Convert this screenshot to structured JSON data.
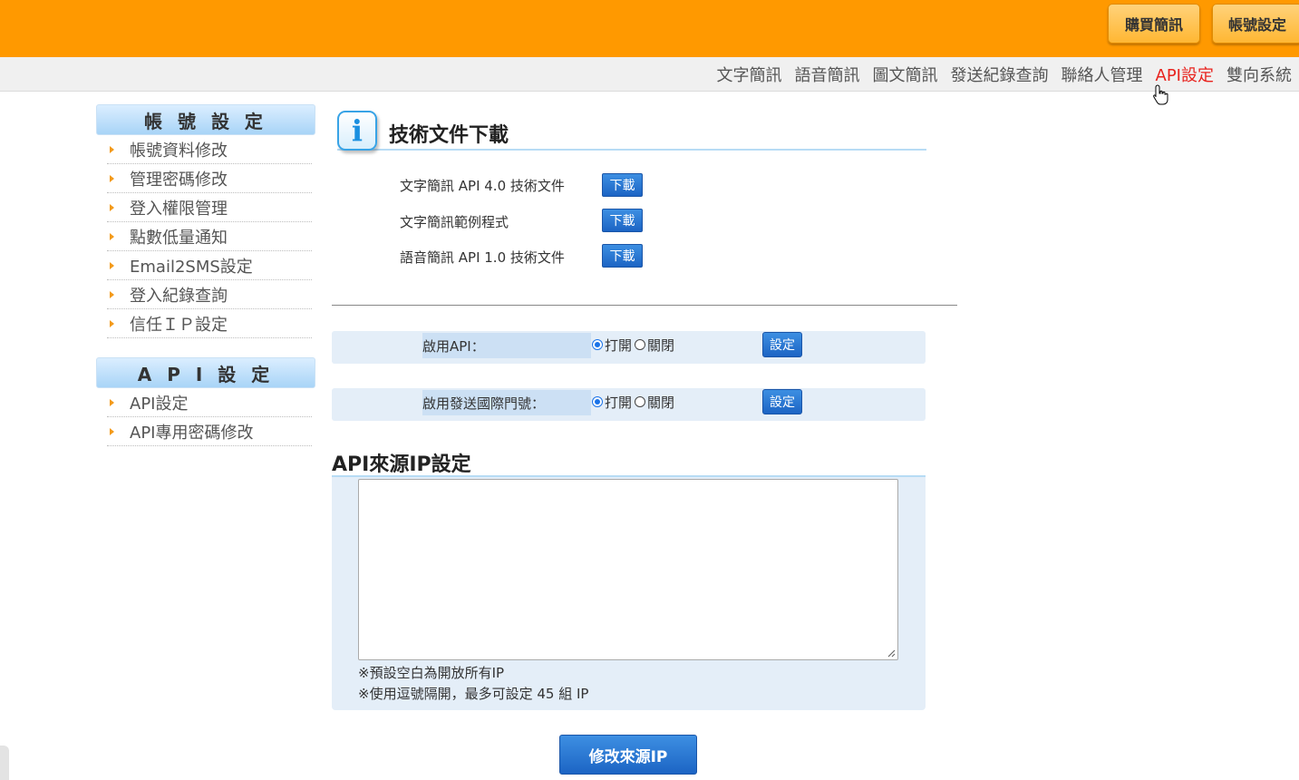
{
  "header": {
    "buy_sms_label": "購買簡訊",
    "account_settings_label": "帳號設定",
    "accent": "#ff9900"
  },
  "nav": {
    "items": [
      {
        "label": "文字簡訊",
        "active": false
      },
      {
        "label": "語音簡訊",
        "active": false
      },
      {
        "label": "圖文簡訊",
        "active": false
      },
      {
        "label": "發送紀錄查詢",
        "active": false
      },
      {
        "label": "聯絡人管理",
        "active": false
      },
      {
        "label": "API設定",
        "active": true
      },
      {
        "label": "雙向系統",
        "active": false
      }
    ],
    "active_color": "#e8231e"
  },
  "sidebar": {
    "account": {
      "title": "帳 號 設 定",
      "items": [
        "帳號資料修改",
        "管理密碼修改",
        "登入權限管理",
        "點數低量通知",
        "Email2SMS設定",
        "登入紀錄查詢",
        "信任ＩＰ設定"
      ]
    },
    "api": {
      "title": "A P I 設 定",
      "items": [
        "API設定",
        "API專用密碼修改"
      ]
    }
  },
  "docs": {
    "title": "技術文件下載",
    "info_icon_glyph": "i",
    "download_label": "下載",
    "rows": [
      "文字簡訊 API 4.0 技術文件",
      "文字簡訊範例程式",
      "語音簡訊 API 1.0 技術文件"
    ]
  },
  "settings": {
    "enable_api": {
      "label": "啟用API：",
      "on_label": "打開",
      "off_label": "關閉",
      "selected": "on",
      "button": "設定"
    },
    "enable_intl": {
      "label": "啟用發送國際門號：",
      "on_label": "打開",
      "off_label": "關閉",
      "selected": "on",
      "button": "設定"
    }
  },
  "ip_settings": {
    "title": "API來源IP設定",
    "value": "",
    "note1": "※預設空白為開放所有IP",
    "note2": "※使用逗號隔開，最多可設定 45 組 IP",
    "submit_label": "修改來源IP"
  }
}
